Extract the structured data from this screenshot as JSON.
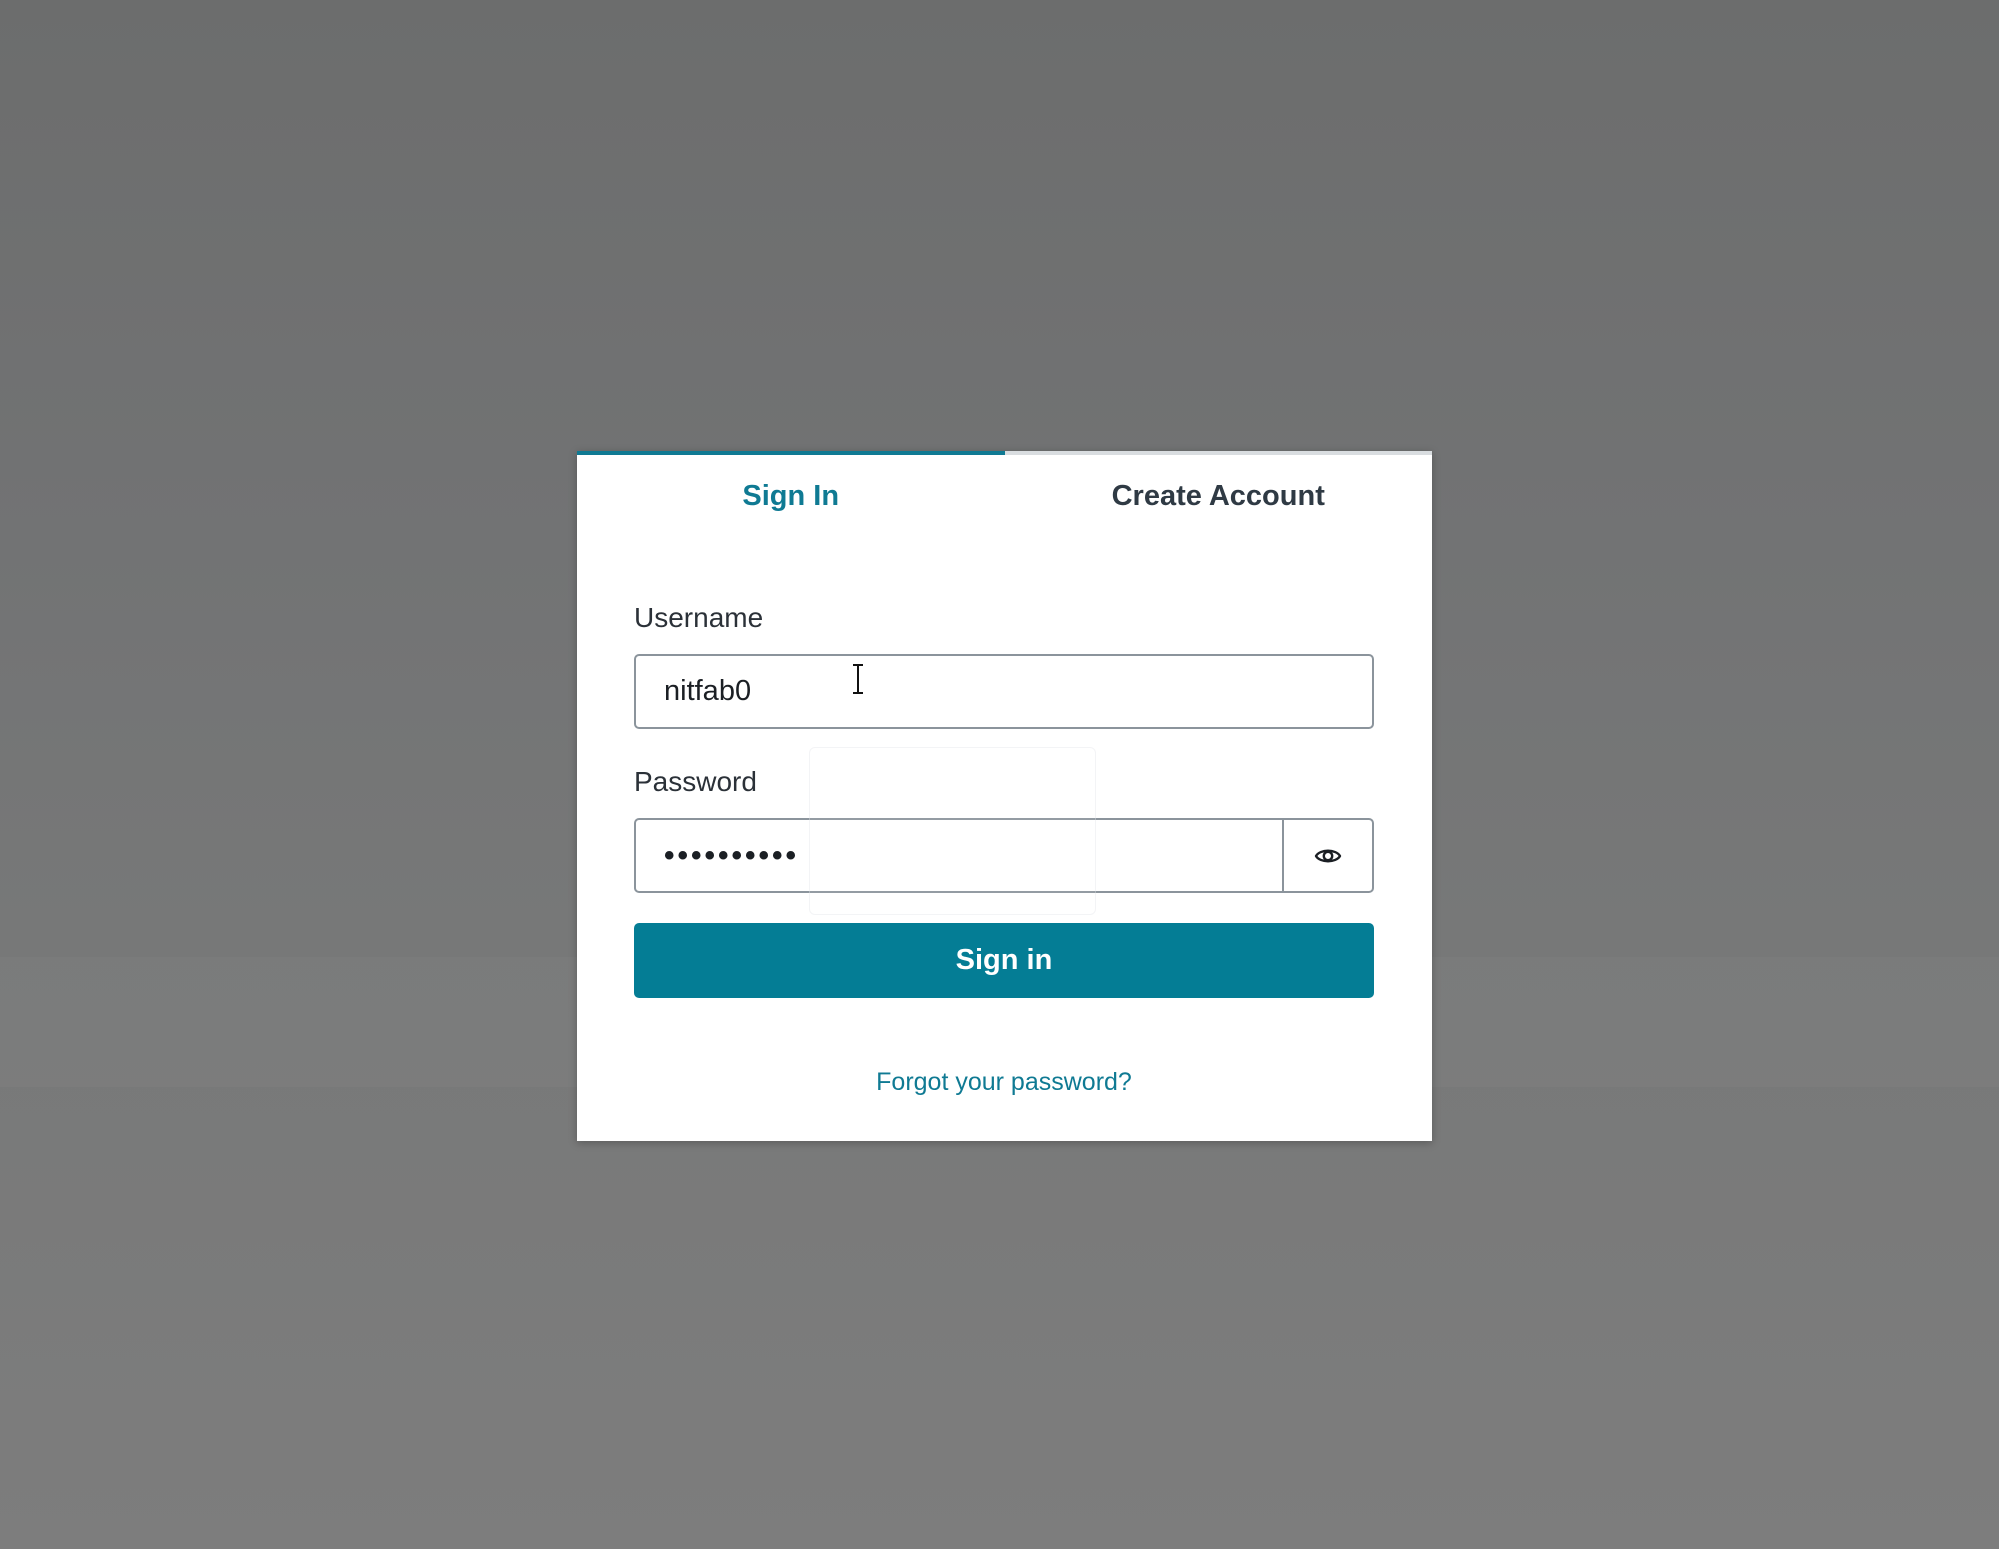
{
  "tabs": [
    {
      "label": "Sign In",
      "active": true
    },
    {
      "label": "Create Account",
      "active": false
    }
  ],
  "form": {
    "username_label": "Username",
    "username_value": "nitfab0",
    "password_label": "Password",
    "password_value": "••••••••••",
    "show_password_icon": "eye-icon",
    "submit_label": "Sign in",
    "forgot_link": "Forgot your password?"
  },
  "colors": {
    "accent": "#047d95",
    "active_tab_text": "#0f7a93",
    "inactive_tab_text": "#2f3a44",
    "backdrop": "#737474"
  }
}
